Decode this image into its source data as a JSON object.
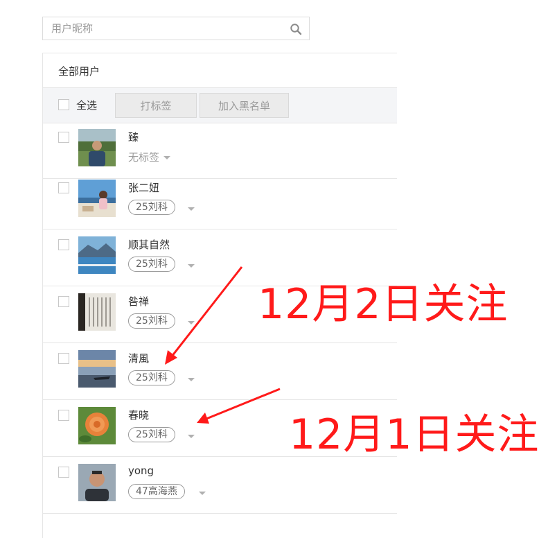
{
  "search": {
    "placeholder": "用户昵称"
  },
  "panel": {
    "title": "全部用户",
    "select_all_label": "全选",
    "tag_button_label": "打标签",
    "blacklist_button_label": "加入黑名单"
  },
  "users": [
    {
      "name": "臻",
      "tag": "无标签"
    },
    {
      "name": "张二妞",
      "tag": "25刘科"
    },
    {
      "name": "顺其自然",
      "tag": "25刘科"
    },
    {
      "name": "咎禅",
      "tag": "25刘科"
    },
    {
      "name": "清風",
      "tag": "25刘科"
    },
    {
      "name": "春晓",
      "tag": "25刘科"
    },
    {
      "name": "yong",
      "tag": "47高海燕"
    }
  ],
  "annotations": {
    "first": "12月2日关注",
    "second": "12月1日关注",
    "color": "#ff1a1a"
  },
  "icons": {
    "search": "search-icon",
    "tag_dropdown": "caret-down-icon"
  }
}
